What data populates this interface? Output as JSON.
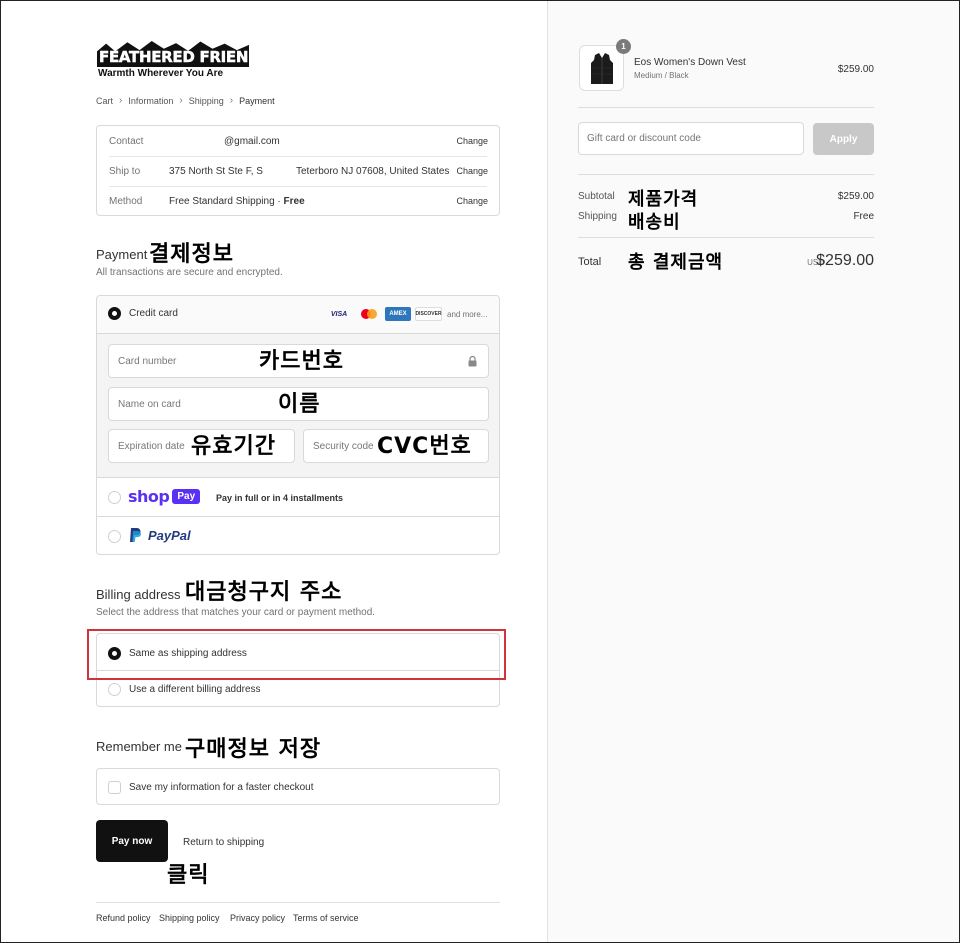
{
  "brand": {
    "name": "FEATHERED FRIENDS",
    "tagline": "Warmth Wherever You Are"
  },
  "breadcrumb": [
    "Cart",
    "Information",
    "Shipping",
    "Payment"
  ],
  "review": {
    "contact_label": "Contact",
    "contact_value": "@gmail.com",
    "contact_change": "Change",
    "ship_label": "Ship to",
    "ship_value_a": "375 North St Ste F, S",
    "ship_value_b": "Teterboro NJ 07608, United States",
    "ship_change": "Change",
    "method_label": "Method",
    "method_value": "Free Standard Shipping · ",
    "method_free": "Free",
    "method_change": "Change"
  },
  "payment": {
    "title": "Payment",
    "note": "결제정보",
    "subtitle": "All transactions are secure and encrypted.",
    "credit_label": "Credit card",
    "logos": [
      "VISA",
      "MC",
      "AMEX",
      "DISCOVER"
    ],
    "and_more": "and more...",
    "card_number": "Card number",
    "card_number_note": "카드번호",
    "name_on_card": "Name on card",
    "name_note": "이름",
    "expiration": "Expiration date",
    "expiration_note": "유효기간",
    "security": "Security code",
    "security_note": "CVC번호",
    "shop_brand": "shop",
    "shop_pay": "Pay",
    "shop_text": "Pay in full or in 4 installments",
    "paypal": "PayPal"
  },
  "billing": {
    "title": "Billing address",
    "note": "대금청구지 주소",
    "subtitle": "Select the address that matches your card or payment method.",
    "same": "Same as shipping address",
    "different": "Use a different billing address"
  },
  "remember": {
    "title": "Remember me",
    "note": "구매정보 저장",
    "save": "Save my information for a faster checkout"
  },
  "actions": {
    "pay_now": "Pay now",
    "return": "Return to shipping",
    "click_note": "클릭"
  },
  "footer": [
    "Refund policy",
    "Shipping policy",
    "Privacy policy",
    "Terms of service"
  ],
  "summary": {
    "item_qty": "1",
    "item_name": "Eos Women's Down Vest",
    "item_variant": "Medium / Black",
    "item_price": "$259.00",
    "discount_placeholder": "Gift card or discount code",
    "apply": "Apply",
    "subtotal_label": "Subtotal",
    "subtotal_note": "제품가격",
    "subtotal_value": "$259.00",
    "shipping_label": "Shipping",
    "shipping_note": "배송비",
    "shipping_value": "Free",
    "total_label": "Total",
    "total_note": "총 결제금액",
    "currency": "USD",
    "total_value": "$259.00"
  },
  "colors": {
    "highlight": "#d0343a",
    "shop_purple": "#5a31f4",
    "paypal_blue": "#253b80",
    "paypal_light": "#179bd7",
    "apply_bg": "#c8c8c8"
  }
}
